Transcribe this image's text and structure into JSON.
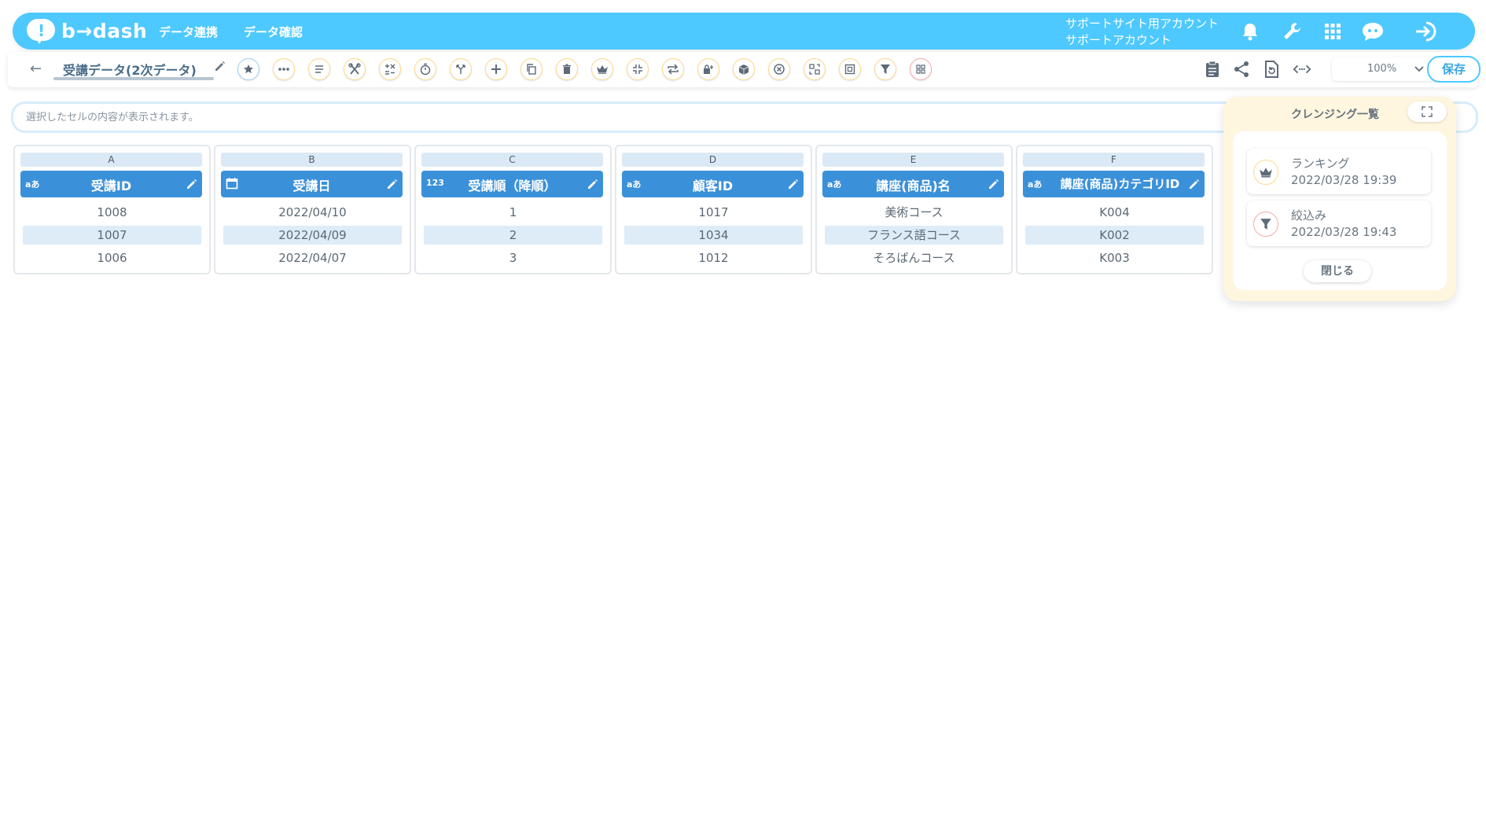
{
  "header": {
    "logo_text": "b→dash",
    "nav": [
      "データ連携",
      "データ確認"
    ],
    "account_line1": "サポートサイト用アカウント",
    "account_line2": "サポートアカウント"
  },
  "toolbar": {
    "sheet_title": "受講データ(2次データ)",
    "zoom": "100%",
    "save_label": "保存",
    "tools": [
      "star-icon",
      "more-icon",
      "list-icon",
      "scissors-icon",
      "calc-icon",
      "timer-icon",
      "branch-icon",
      "plus-icon",
      "copy-icon",
      "trash-icon",
      "crown-icon",
      "collapse-icon",
      "repeat-icon",
      "lock-icon",
      "box-icon",
      "cancel-icon",
      "replace-icon",
      "frame-icon",
      "filter-icon",
      "grid-icon"
    ]
  },
  "cellbar": {
    "placeholder": "選択したセルの内容が表示されます。"
  },
  "columns": [
    {
      "letter": "A",
      "name": "受講ID",
      "type": "aあ",
      "values": [
        "1008",
        "1007",
        "1006"
      ]
    },
    {
      "letter": "B",
      "name": "受講日",
      "type": "calendar",
      "values": [
        "2022/04/10",
        "2022/04/09",
        "2022/04/07"
      ]
    },
    {
      "letter": "C",
      "name": "受講順（降順）",
      "type": "123",
      "values": [
        "1",
        "2",
        "3"
      ]
    },
    {
      "letter": "D",
      "name": "顧客ID",
      "type": "aあ",
      "values": [
        "1017",
        "1034",
        "1012"
      ]
    },
    {
      "letter": "E",
      "name": "講座(商品)名",
      "type": "aあ",
      "values": [
        "美術コース",
        "フランス語コース",
        "そろばんコース"
      ]
    },
    {
      "letter": "F",
      "name": "講座(商品)カテゴリID",
      "type": "aあ",
      "values": [
        "K004",
        "K002",
        "K003"
      ]
    }
  ],
  "cleansing_panel": {
    "title": "クレンジング一覧",
    "entries": [
      {
        "name": "ランキング",
        "time": "2022/03/28 19:39",
        "icon": "crown-icon"
      },
      {
        "name": "絞込み",
        "time": "2022/03/28 19:43",
        "icon": "filter-icon"
      }
    ],
    "close_label": "閉じる"
  },
  "colors": {
    "header_bg": "#4ec9ff",
    "column_head_bg": "#3b91d9",
    "panel_bg": "#fff6df"
  }
}
